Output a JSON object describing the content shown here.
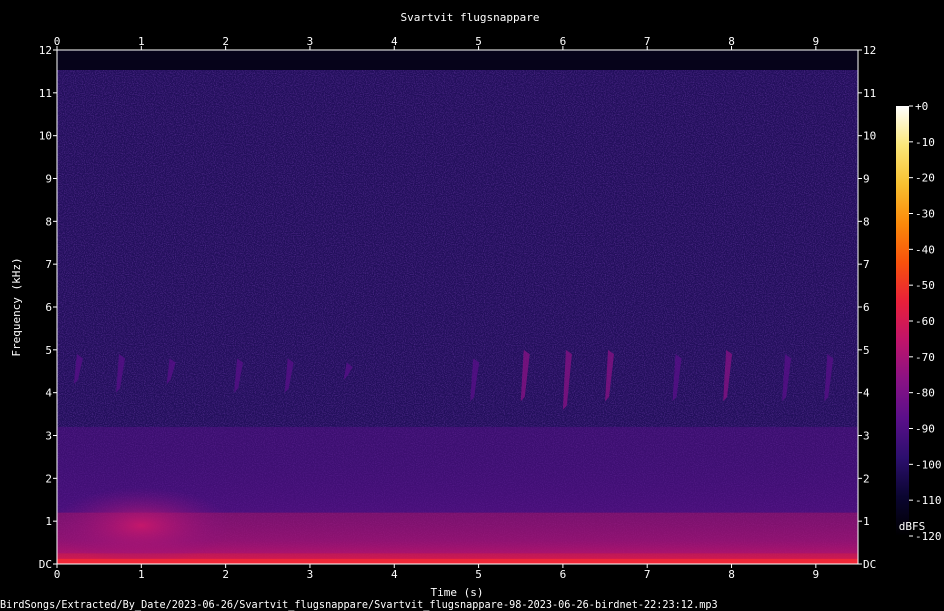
{
  "chart_data": {
    "type": "heatmap",
    "title": "Svartvit flugsnappare",
    "xlabel": "Time (s)",
    "ylabel": "Frequency (kHz)",
    "xlim": [
      0,
      9.5
    ],
    "ylim": [
      0,
      12
    ],
    "x_ticks": [
      "0",
      "1",
      "2",
      "3",
      "4",
      "5",
      "6",
      "7",
      "8",
      "9"
    ],
    "y_ticks": [
      "DC",
      "1",
      "2",
      "3",
      "4",
      "5",
      "6",
      "7",
      "8",
      "9",
      "10",
      "11",
      "12"
    ],
    "colorbar": {
      "unit": "dBFS",
      "range": [
        -120,
        0
      ],
      "ticks": [
        "+0",
        "-10",
        "-20",
        "-30",
        "-40",
        "-50",
        "-60",
        "-70",
        "-80",
        "-90",
        "-100",
        "-110",
        "-120"
      ],
      "colors": [
        "#000000",
        "#0a0530",
        "#2c0f6e",
        "#5a0f8a",
        "#8a1284",
        "#c0146a",
        "#e8203a",
        "#f8520c",
        "#fb8a0a",
        "#f8c030",
        "#fbe87a",
        "#ffffff"
      ]
    },
    "background_level_dbfs": -100,
    "noise_ceiling_khz": 11.5,
    "calls": [
      {
        "t": 0.2,
        "f_low": 4.2,
        "f_high": 4.9,
        "level_dbfs": -85
      },
      {
        "t": 0.7,
        "f_low": 4.0,
        "f_high": 4.9,
        "level_dbfs": -83
      },
      {
        "t": 1.3,
        "f_low": 4.2,
        "f_high": 4.8,
        "level_dbfs": -88
      },
      {
        "t": 2.1,
        "f_low": 4.0,
        "f_high": 4.8,
        "level_dbfs": -85
      },
      {
        "t": 2.7,
        "f_low": 4.0,
        "f_high": 4.8,
        "level_dbfs": -85
      },
      {
        "t": 3.4,
        "f_low": 4.3,
        "f_high": 4.7,
        "level_dbfs": -88
      },
      {
        "t": 4.9,
        "f_low": 3.8,
        "f_high": 4.8,
        "level_dbfs": -84
      },
      {
        "t": 5.5,
        "f_low": 3.8,
        "f_high": 5.0,
        "level_dbfs": -80
      },
      {
        "t": 6.0,
        "f_low": 3.6,
        "f_high": 5.0,
        "level_dbfs": -80
      },
      {
        "t": 6.5,
        "f_low": 3.8,
        "f_high": 5.0,
        "level_dbfs": -80
      },
      {
        "t": 7.3,
        "f_low": 3.8,
        "f_high": 4.9,
        "level_dbfs": -82
      },
      {
        "t": 7.9,
        "f_low": 3.8,
        "f_high": 5.0,
        "level_dbfs": -80
      },
      {
        "t": 8.6,
        "f_low": 3.8,
        "f_high": 4.9,
        "level_dbfs": -82
      },
      {
        "t": 9.1,
        "f_low": 3.8,
        "f_high": 4.9,
        "level_dbfs": -82
      }
    ],
    "low_band_energy": [
      {
        "f_low": 0.0,
        "f_high": 0.25,
        "level_dbfs": -50
      },
      {
        "f_low": 0.25,
        "f_high": 1.2,
        "level_dbfs": -70
      },
      {
        "f_low": 1.2,
        "f_high": 3.2,
        "level_dbfs": -85
      }
    ]
  },
  "footer": {
    "filename": "BirdSongs/Extracted/By_Date/2023-06-26/Svartvit_flugsnappare/Svartvit_flugsnappare-98-2023-06-26-birdnet-22:23:12.mp3"
  }
}
